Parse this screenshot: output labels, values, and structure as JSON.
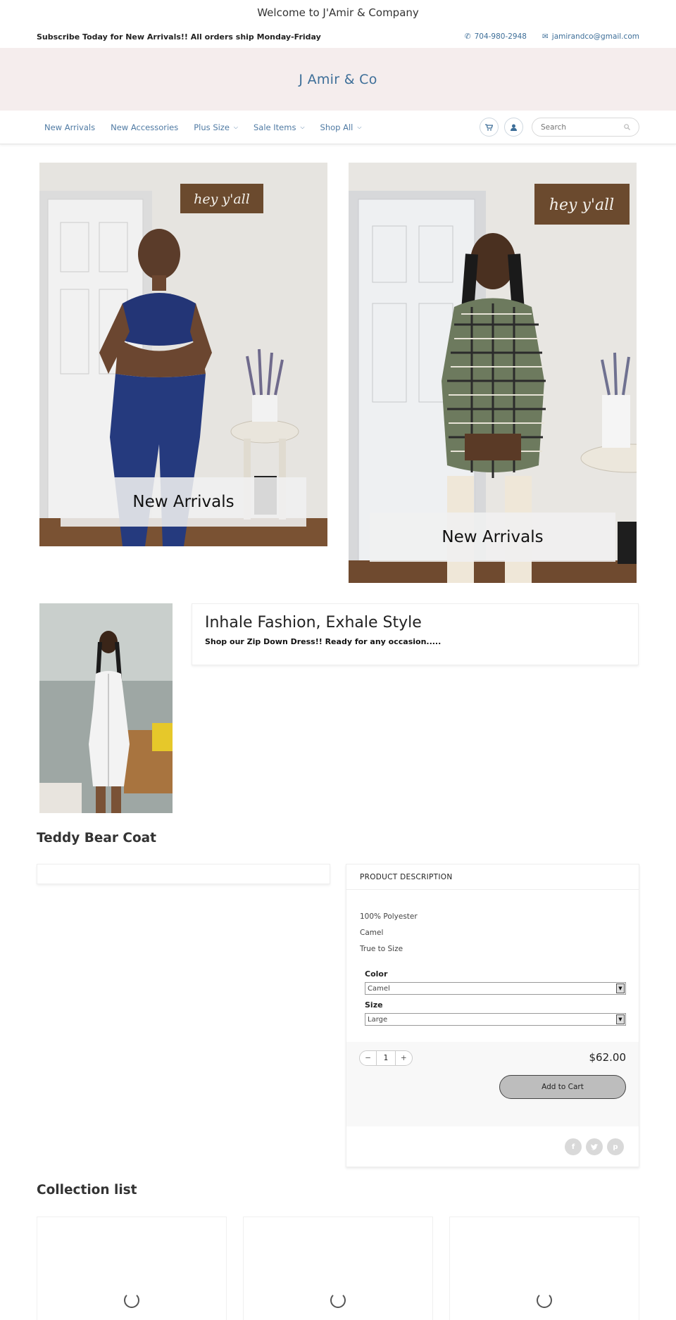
{
  "header": {
    "welcome": "Welcome to J'Amir & Company",
    "promo": "Subscribe Today for New Arrivals!! All orders ship Monday-Friday",
    "phone": "704-980-2948",
    "email": "jamirandco@gmail.com",
    "logo": "J Amir & Co"
  },
  "nav": {
    "items": [
      {
        "label": "New Arrivals",
        "dropdown": false
      },
      {
        "label": "New Accessories",
        "dropdown": false
      },
      {
        "label": "Plus Size",
        "dropdown": true
      },
      {
        "label": "Sale Items",
        "dropdown": true
      },
      {
        "label": "Shop All",
        "dropdown": true
      }
    ],
    "search_placeholder": "Search"
  },
  "hero": {
    "left_label": "New Arrivals",
    "right_label": "New Arrivals",
    "sign_text": "hey y'all"
  },
  "feature": {
    "heading": "Inhale Fashion, Exhale Style",
    "text": "Shop our Zip Down Dress!! Ready for any occasion....."
  },
  "product": {
    "title": "Teddy Bear Coat",
    "description_heading": "PRODUCT DESCRIPTION",
    "description_lines": [
      "100% Polyester",
      "Camel",
      "True to Size"
    ],
    "color_label": "Color",
    "color_value": "Camel",
    "size_label": "Size",
    "size_value": "Large",
    "quantity": "1",
    "price": "$62.00",
    "add_to_cart": "Add to Cart"
  },
  "collection": {
    "title": "Collection list"
  },
  "colors": {
    "accent": "#3d6e98",
    "logo_band": "#f5eded"
  }
}
